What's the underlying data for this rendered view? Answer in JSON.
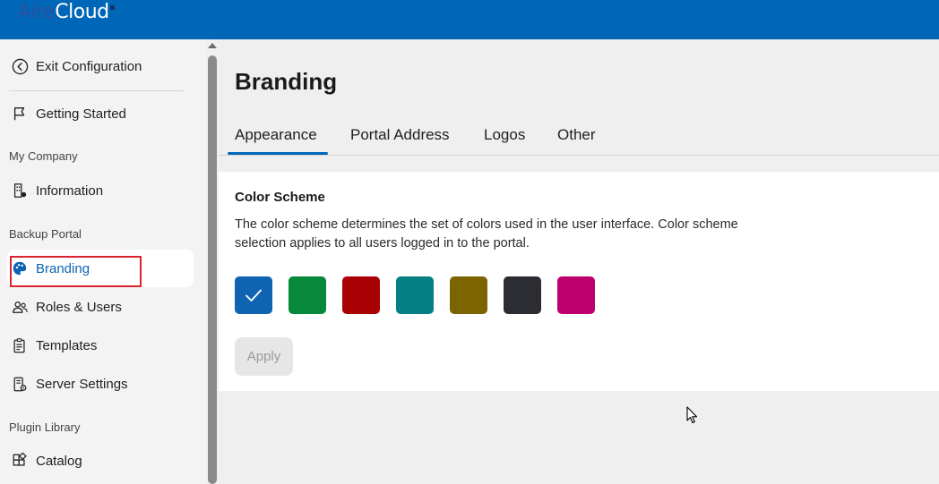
{
  "brand": {
    "logo_part1": "Aire",
    "logo_part2": "Cloud"
  },
  "sidebar": {
    "exit_label": "Exit Configuration",
    "getting_started_label": "Getting Started",
    "sections": {
      "my_company": "My Company",
      "backup_portal": "Backup Portal",
      "plugin_library": "Plugin Library"
    },
    "items": {
      "information": "Information",
      "branding": "Branding",
      "roles_users": "Roles & Users",
      "templates": "Templates",
      "server_settings": "Server Settings",
      "catalog": "Catalog"
    },
    "active_item": "Branding"
  },
  "main": {
    "title": "Branding",
    "tabs": [
      {
        "label": "Appearance",
        "active": true
      },
      {
        "label": "Portal Address",
        "active": false
      },
      {
        "label": "Logos",
        "active": false
      },
      {
        "label": "Other",
        "active": false
      }
    ],
    "color_scheme": {
      "title": "Color Scheme",
      "description": "The color scheme determines the set of colors used in the user interface. Color scheme selection applies to all users logged in to the portal.",
      "swatches": [
        {
          "color": "#0f63b0",
          "selected": true
        },
        {
          "color": "#07893c",
          "selected": false
        },
        {
          "color": "#a90004",
          "selected": false
        },
        {
          "color": "#058186",
          "selected": false
        },
        {
          "color": "#7c6400",
          "selected": false
        },
        {
          "color": "#2b2d32",
          "selected": false
        },
        {
          "color": "#bd006e",
          "selected": false
        }
      ],
      "apply_label": "Apply"
    }
  },
  "colors": {
    "accent": "#0067b8",
    "highlight": "#d9232e"
  }
}
